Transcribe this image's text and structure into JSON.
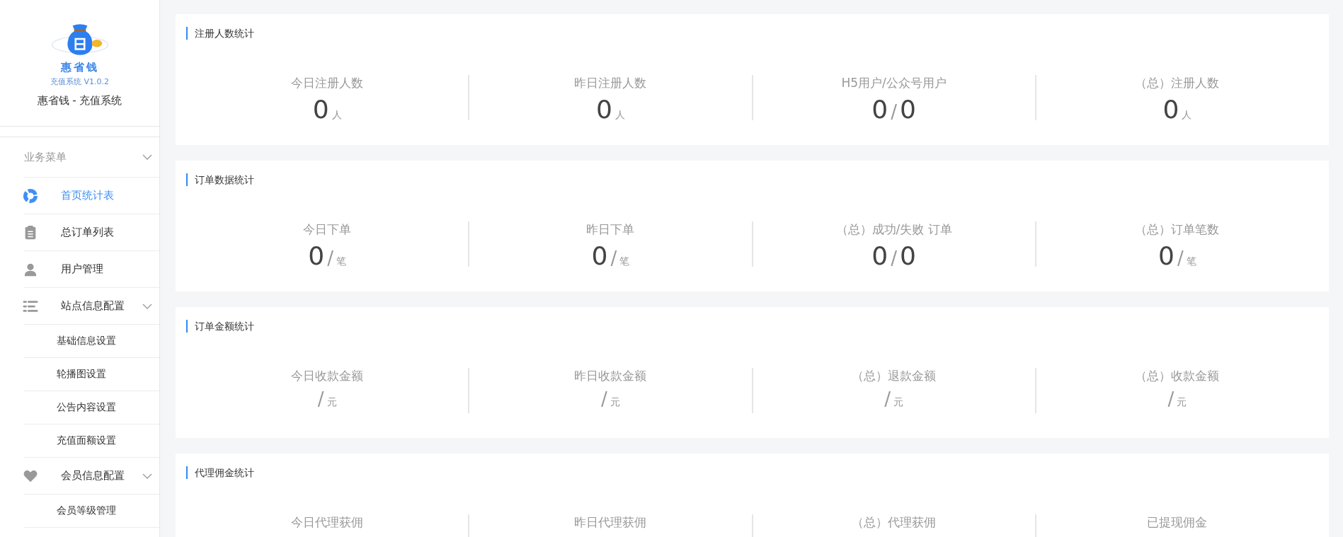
{
  "sidebar": {
    "logo_text": "惠省钱",
    "logo_caption": "充值系统 V1.0.2",
    "app_name": "惠省钱 - 充值系统",
    "items": [
      {
        "kind": "section",
        "label": "业务菜单",
        "expanded": true
      },
      {
        "kind": "item",
        "label": "首页统计表",
        "selected": true
      },
      {
        "kind": "item",
        "label": "总订单列表",
        "selected": false
      },
      {
        "kind": "item",
        "label": "用户管理",
        "selected": false
      },
      {
        "kind": "group",
        "label": "站点信息配置",
        "expanded": true,
        "selected": false
      },
      {
        "kind": "sub",
        "label": "基础信息设置",
        "selected": false
      },
      {
        "kind": "sub",
        "label": "轮播图设置",
        "selected": false
      },
      {
        "kind": "sub",
        "label": "公告内容设置",
        "selected": false
      },
      {
        "kind": "sub",
        "label": "充值面额设置",
        "selected": false
      },
      {
        "kind": "group",
        "label": "会员信息配置",
        "expanded": true,
        "selected": false
      },
      {
        "kind": "sub",
        "label": "会员等级管理",
        "selected": false
      }
    ]
  },
  "cards": [
    {
      "title": "注册人数统计",
      "stats": [
        {
          "label": "今日注册人数",
          "parts": [
            {
              "kind": "number",
              "text": "0"
            },
            {
              "kind": "unit",
              "text": "人"
            }
          ]
        },
        {
          "label": "昨日注册人数",
          "parts": [
            {
              "kind": "number",
              "text": "0"
            },
            {
              "kind": "unit",
              "text": "人"
            }
          ]
        },
        {
          "label": "H5用户/公众号用户",
          "parts": [
            {
              "kind": "number",
              "text": "0"
            },
            {
              "kind": "sep",
              "text": "/"
            },
            {
              "kind": "number",
              "text": "0"
            }
          ]
        },
        {
          "label": "（总）注册人数",
          "parts": [
            {
              "kind": "number",
              "text": "0"
            },
            {
              "kind": "unit",
              "text": "人"
            }
          ]
        }
      ]
    },
    {
      "title": "订单数据统计",
      "stats": [
        {
          "label": "今日下单",
          "parts": [
            {
              "kind": "number",
              "text": "0"
            },
            {
              "kind": "sep",
              "text": "/"
            },
            {
              "kind": "unit",
              "text": "笔"
            }
          ]
        },
        {
          "label": "昨日下单",
          "parts": [
            {
              "kind": "number",
              "text": "0"
            },
            {
              "kind": "sep",
              "text": "/"
            },
            {
              "kind": "unit",
              "text": "笔"
            }
          ]
        },
        {
          "label": "（总）成功/失败 订单",
          "parts": [
            {
              "kind": "number",
              "text": "0"
            },
            {
              "kind": "sep",
              "text": "/"
            },
            {
              "kind": "number",
              "text": "0"
            }
          ]
        },
        {
          "label": "（总）订单笔数",
          "parts": [
            {
              "kind": "number",
              "text": "0"
            },
            {
              "kind": "sep",
              "text": "/"
            },
            {
              "kind": "unit",
              "text": "笔"
            }
          ]
        }
      ]
    },
    {
      "title": "订单金额统计",
      "stats": [
        {
          "label": "今日收款金额",
          "parts": [
            {
              "kind": "sep",
              "text": "/"
            },
            {
              "kind": "unit",
              "text": "元"
            }
          ]
        },
        {
          "label": "昨日收款金额",
          "parts": [
            {
              "kind": "sep",
              "text": "/"
            },
            {
              "kind": "unit",
              "text": "元"
            }
          ]
        },
        {
          "label": "（总）退款金额",
          "parts": [
            {
              "kind": "sep",
              "text": "/"
            },
            {
              "kind": "unit",
              "text": "元"
            }
          ]
        },
        {
          "label": "（总）收款金额",
          "parts": [
            {
              "kind": "sep",
              "text": "/"
            },
            {
              "kind": "unit",
              "text": "元"
            }
          ]
        }
      ]
    },
    {
      "title": "代理佣金统计",
      "stats": [
        {
          "label": "今日代理获佣"
        },
        {
          "label": "昨日代理获佣"
        },
        {
          "label": "（总）代理获佣"
        },
        {
          "label": "已提现佣金"
        }
      ]
    }
  ]
}
